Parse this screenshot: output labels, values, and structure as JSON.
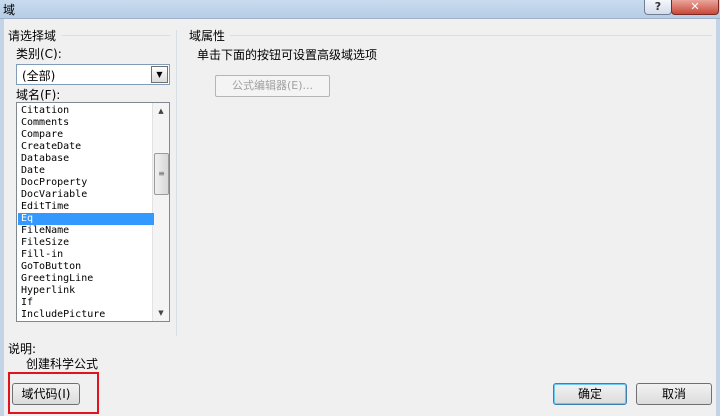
{
  "window": {
    "title": "域",
    "help_glyph": "?",
    "close_glyph": "✕"
  },
  "left_panel": {
    "group_title": "请选择域",
    "category_label": "类别(C):",
    "category_value": "(全部)",
    "fieldname_label": "域名(F):",
    "fields": [
      "Citation",
      "Comments",
      "Compare",
      "CreateDate",
      "Database",
      "Date",
      "DocProperty",
      "DocVariable",
      "EditTime",
      "Eq",
      "FileName",
      "FileSize",
      "Fill-in",
      "GoToButton",
      "GreetingLine",
      "Hyperlink",
      "If",
      "IncludePicture"
    ],
    "selected_field": "Eq"
  },
  "right_panel": {
    "group_title": "域属性",
    "instruction": "单击下面的按钮可设置高级域选项",
    "formula_editor_button": "公式编辑器(E)..."
  },
  "description": {
    "label": "说明:",
    "text": "创建科学公式"
  },
  "footer": {
    "field_codes_button": "域代码(I)",
    "ok_button": "确定",
    "cancel_button": "取消"
  }
}
